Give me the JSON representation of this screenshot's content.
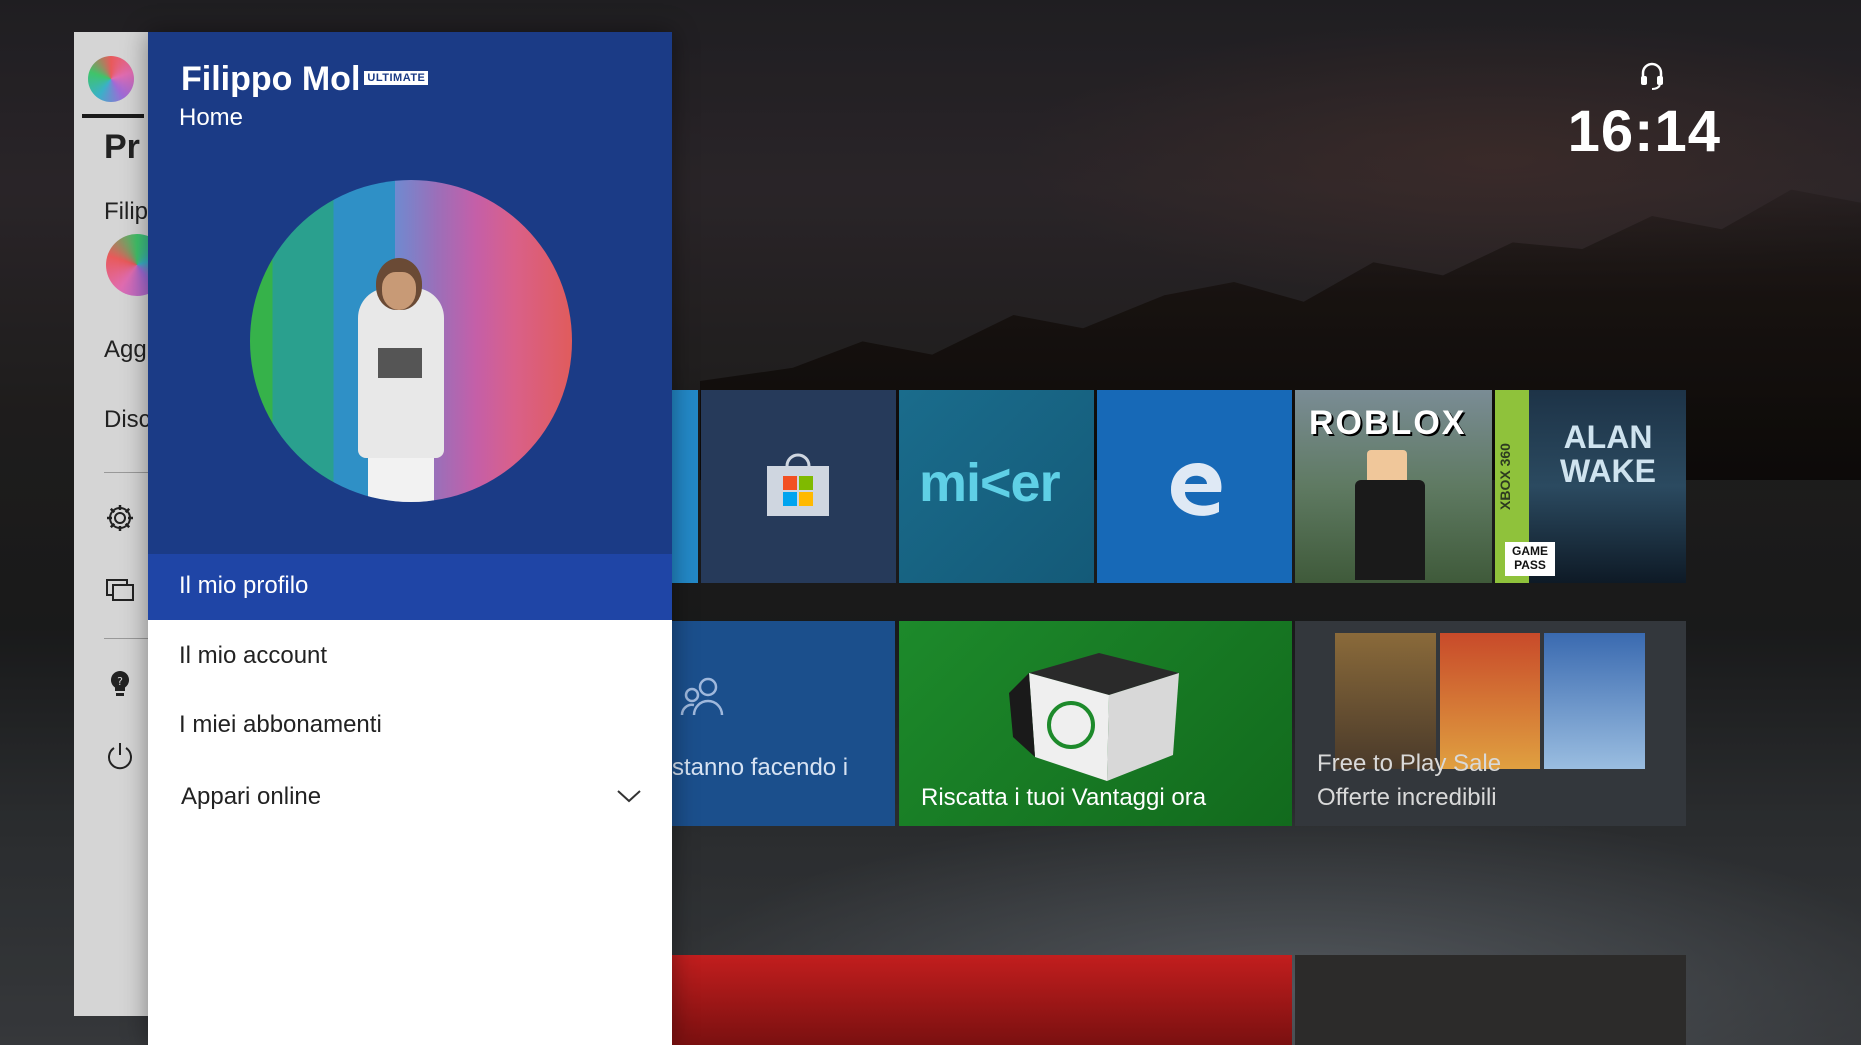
{
  "profile": {
    "gamertag": "Filippo Mol",
    "badge": "ULTIMATE",
    "subtitle": "Home"
  },
  "menu": {
    "items": [
      {
        "label": "Il mio profilo",
        "selected": true
      },
      {
        "label": "Il mio account"
      },
      {
        "label": "I miei abbonamenti"
      },
      {
        "label": "Appari online",
        "icon": "chevron-down-icon"
      }
    ]
  },
  "guide": {
    "heading": "Pr",
    "user": "Filip",
    "item_add": "Agg",
    "item_disc": "Disc",
    "icons": [
      "gear-icon",
      "screens-icon",
      "tips-icon",
      "power-icon"
    ]
  },
  "status": {
    "time": "16:14",
    "icon": "headset-icon"
  },
  "tiles": {
    "mixer": "mi<er",
    "roblox": "ROBLOX",
    "x360": "XBOX 360",
    "gamepass": "GAME PASS",
    "alanwake": "ALAN WAKE",
    "friends": "stanno facendo i",
    "rewards": "Riscatta i tuoi Vantaggi ora",
    "sale_line1": "Free to Play Sale",
    "sale_line2": "Offerte incredibili"
  },
  "colors": {
    "panel_header": "#1b3b86",
    "menu_selected": "#1f45a6",
    "edge_tile": "#1769b7",
    "rewards_tile": "#1d8a2b"
  }
}
